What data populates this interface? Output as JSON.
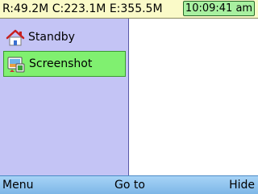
{
  "status_bar": {
    "memory_text": "R:49.2M C:223.1M E:355.5M",
    "clock": "10:09:41 am"
  },
  "task_list": {
    "items": [
      {
        "label": "Standby",
        "icon": "home-icon",
        "selected": false
      },
      {
        "label": "Screenshot",
        "icon": "screenshot-app-icon",
        "selected": true
      }
    ]
  },
  "softkeys": {
    "left": "Menu",
    "middle": "Go to",
    "right": "Hide"
  },
  "colors": {
    "status_bar_bg": "#fafac8",
    "clock_bg": "#a8f0a0",
    "list_bg": "#c4c4f5",
    "selection_bg": "#80f070",
    "softkey_bg": "#9fcdf3"
  }
}
